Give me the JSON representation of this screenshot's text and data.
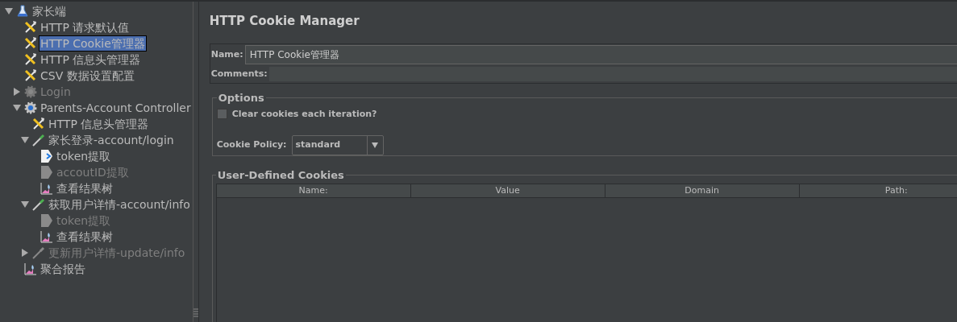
{
  "tree": [
    {
      "label": "家长端",
      "kind": "plan",
      "expanded": true,
      "disabled": false,
      "selected": false,
      "children": [
        {
          "label": "HTTP 请求默认值",
          "kind": "config",
          "disabled": false,
          "selected": false
        },
        {
          "label": "HTTP Cookie管理器",
          "kind": "config",
          "disabled": false,
          "selected": true
        },
        {
          "label": "HTTP 信息头管理器",
          "kind": "config",
          "disabled": false,
          "selected": false
        },
        {
          "label": "CSV 数据设置配置",
          "kind": "config",
          "disabled": false,
          "selected": false
        },
        {
          "label": "Login",
          "kind": "controller",
          "expanded": false,
          "disabled": true,
          "selected": false
        },
        {
          "label": "Parents-Account Controller",
          "kind": "controller",
          "expanded": true,
          "disabled": false,
          "selected": false,
          "children": [
            {
              "label": "HTTP 信息头管理器",
              "kind": "config",
              "disabled": false,
              "selected": false
            },
            {
              "label": "家长登录-account/login",
              "kind": "sampler",
              "expanded": true,
              "disabled": false,
              "selected": false,
              "children": [
                {
                  "label": "token提取",
                  "kind": "extractor",
                  "disabled": false,
                  "selected": false
                },
                {
                  "label": "accoutID提取",
                  "kind": "extractor",
                  "disabled": true,
                  "selected": false
                },
                {
                  "label": "查看结果树",
                  "kind": "listener",
                  "disabled": false,
                  "selected": false
                }
              ]
            },
            {
              "label": "获取用户详情-account/info",
              "kind": "sampler",
              "expanded": true,
              "disabled": false,
              "selected": false,
              "children": [
                {
                  "label": "token提取",
                  "kind": "extractor",
                  "disabled": true,
                  "selected": false
                },
                {
                  "label": "查看结果树",
                  "kind": "listener",
                  "disabled": false,
                  "selected": false
                }
              ]
            },
            {
              "label": "更新用户详情-update/info",
              "kind": "sampler",
              "expanded": false,
              "disabled": true,
              "selected": false
            }
          ]
        },
        {
          "label": "聚合报告",
          "kind": "listener",
          "disabled": false,
          "selected": false
        }
      ]
    }
  ],
  "panel": {
    "title": "HTTP Cookie Manager",
    "name_label": "Name:",
    "name_value": "HTTP Cookie管理器",
    "comments_label": "Comments:",
    "options": {
      "legend": "Options",
      "clear_label": "Clear cookies each iteration?",
      "clear_checked": false,
      "policy_label": "Cookie Policy:",
      "policy_value": "standard"
    },
    "cookies": {
      "legend": "User-Defined Cookies",
      "columns": [
        "Name:",
        "Value",
        "Domain",
        "Path:"
      ]
    }
  }
}
